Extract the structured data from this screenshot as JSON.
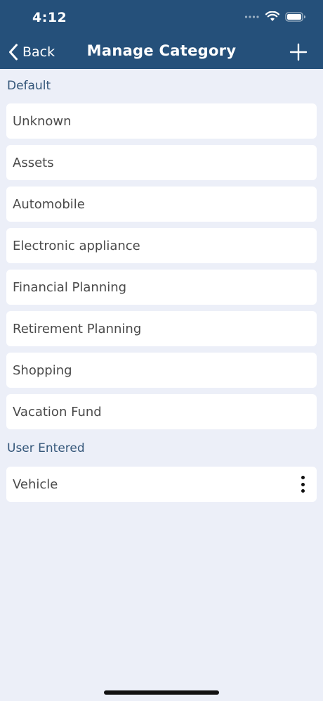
{
  "status_bar": {
    "time": "4:12",
    "icons": [
      "signal-dots-icon",
      "wifi-icon",
      "battery-icon"
    ]
  },
  "nav": {
    "back_label": "Back",
    "title": "Manage Category",
    "add_icon": "plus-icon"
  },
  "colors": {
    "header_bg": "#25507a",
    "page_bg": "#eceff8",
    "section_text": "#35577a",
    "item_bg": "#ffffff",
    "item_text": "#4a4a4a"
  },
  "sections": {
    "default": {
      "title": "Default",
      "items": [
        {
          "label": "Unknown"
        },
        {
          "label": "Assets"
        },
        {
          "label": "Automobile"
        },
        {
          "label": "Electronic appliance"
        },
        {
          "label": "Financial Planning"
        },
        {
          "label": "Retirement Planning"
        },
        {
          "label": "Shopping"
        },
        {
          "label": "Vacation Fund"
        }
      ]
    },
    "user_entered": {
      "title": "User Entered",
      "items": [
        {
          "label": "Vehicle",
          "action_icon": "more-vertical-icon"
        }
      ]
    }
  }
}
